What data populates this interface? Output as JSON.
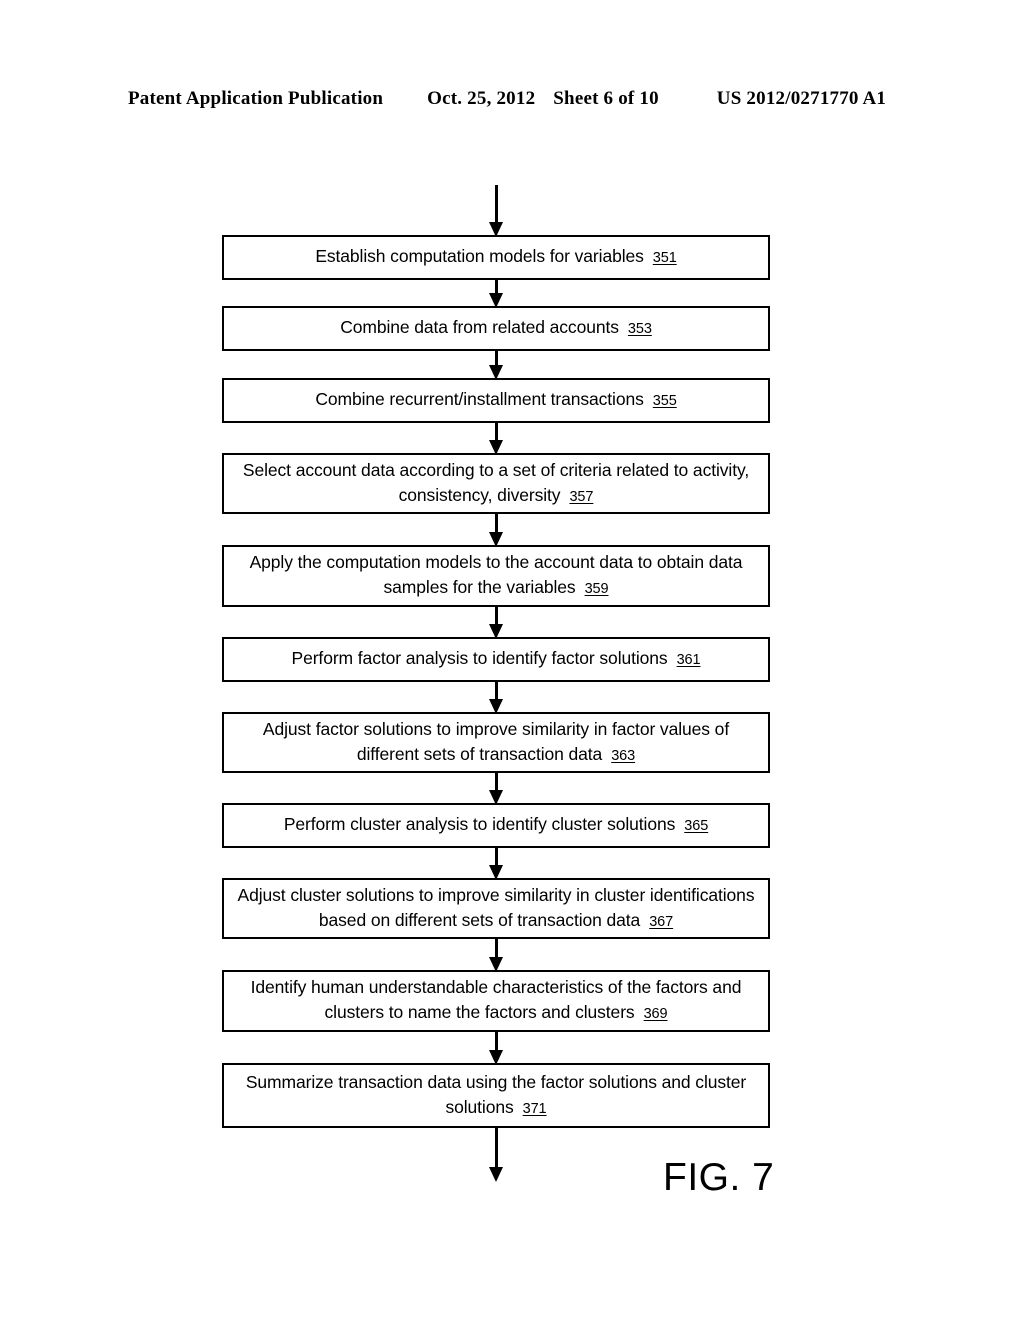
{
  "header": {
    "publication": "Patent Application Publication",
    "date": "Oct. 25, 2012",
    "sheet": "Sheet 6 of 10",
    "document_number": "US 2012/0271770 A1"
  },
  "figure": {
    "label": "FIG. 7",
    "type": "flowchart",
    "orientation": "vertical",
    "entry_arrow": true,
    "exit_arrow": true,
    "steps": [
      {
        "text": "Establish computation models for variables",
        "ref": "351"
      },
      {
        "text": "Combine data from related accounts",
        "ref": "353"
      },
      {
        "text": "Combine recurrent/installment transactions",
        "ref": "355"
      },
      {
        "text": "Select account data according to a set of criteria related to activity, consistency, diversity",
        "ref": "357"
      },
      {
        "text": "Apply the computation models to the account data to obtain data samples for the variables",
        "ref": "359"
      },
      {
        "text": "Perform factor analysis to identify factor solutions",
        "ref": "361"
      },
      {
        "text": "Adjust factor solutions to improve similarity in factor values of different sets of transaction data",
        "ref": "363"
      },
      {
        "text": "Perform cluster analysis to identify cluster solutions",
        "ref": "365"
      },
      {
        "text": "Adjust cluster solutions to improve similarity in cluster identifications based on different sets of transaction data",
        "ref": "367"
      },
      {
        "text": "Identify human understandable characteristics of the factors and clusters to name the factors and clusters",
        "ref": "369"
      },
      {
        "text": "Summarize transaction data using the factor solutions and cluster solutions",
        "ref": "371"
      }
    ]
  },
  "colors": {
    "ink": "#000000",
    "page": "#ffffff"
  }
}
